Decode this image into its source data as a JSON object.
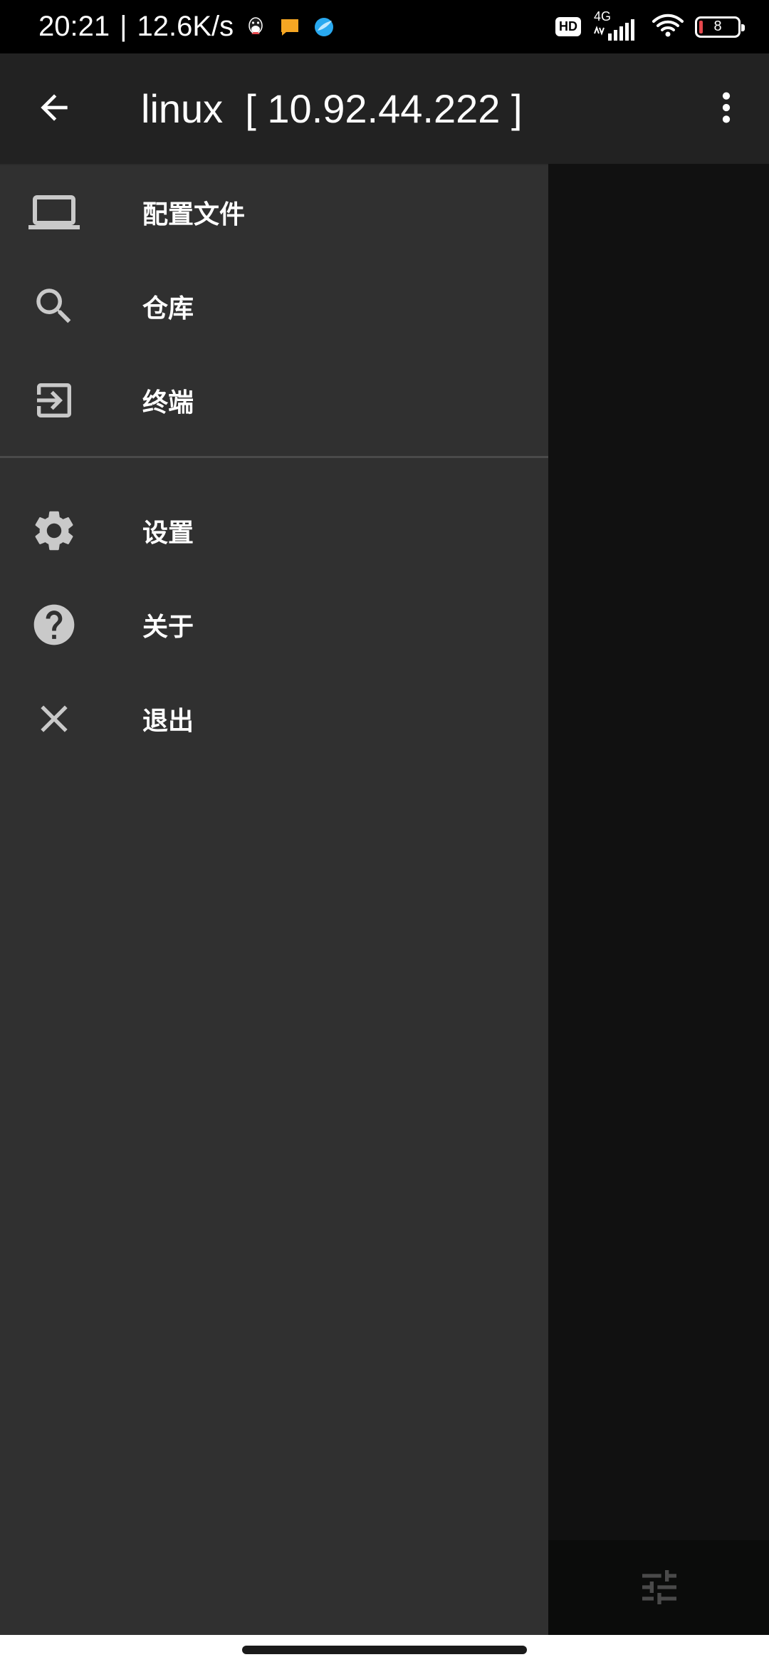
{
  "status_bar": {
    "time": "20:21",
    "separator": "|",
    "speed": "12.6K/s",
    "notif_icons": [
      "qq-icon",
      "message-icon",
      "browser-icon"
    ],
    "hd": "HD",
    "network": "4G",
    "battery": "8"
  },
  "app_bar": {
    "title": "linux  [ 10.92.44.222 ]",
    "back_icon": "arrow-back-icon",
    "more_icon": "more-vert-icon"
  },
  "drawer": {
    "group1": [
      {
        "label": "配置文件",
        "icon": "laptop-icon"
      },
      {
        "label": "仓库",
        "icon": "search-icon"
      },
      {
        "label": "终端",
        "icon": "exit-to-app-icon"
      }
    ],
    "group2": [
      {
        "label": "设置",
        "icon": "gear-icon"
      },
      {
        "label": "关于",
        "icon": "help-icon"
      },
      {
        "label": "退出",
        "icon": "close-icon"
      }
    ]
  },
  "colors": {
    "status_bar_bg": "#000000",
    "app_bar_bg": "#222222",
    "drawer_bg": "#303030",
    "content_bg": "#111111",
    "icon_gray": "#c9c9c9",
    "text": "#ffffff"
  }
}
